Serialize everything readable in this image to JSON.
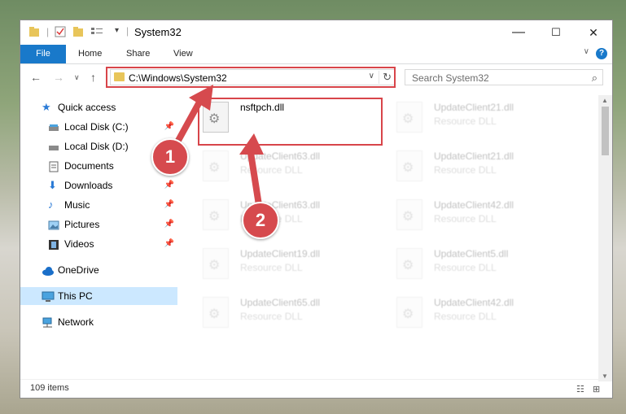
{
  "window": {
    "title": "System32",
    "controls": {
      "minimize": "—",
      "maximize": "☐",
      "close": "✕"
    }
  },
  "ribbon": {
    "file_label": "File",
    "tabs": [
      "Home",
      "Share",
      "View"
    ],
    "help_label": "?"
  },
  "address": {
    "path": "C:\\Windows\\System32",
    "search_placeholder": "Search System32"
  },
  "sidebar": {
    "items": [
      {
        "label": "Quick access",
        "icon": "star-icon",
        "pinned": false
      },
      {
        "label": "Local Disk (C:)",
        "icon": "disk-icon",
        "pinned": true
      },
      {
        "label": "Local Disk (D:)",
        "icon": "disk-icon",
        "pinned": false
      },
      {
        "label": "Documents",
        "icon": "documents-icon",
        "pinned": false
      },
      {
        "label": "Downloads",
        "icon": "download-icon",
        "pinned": true
      },
      {
        "label": "Music",
        "icon": "music-icon",
        "pinned": true
      },
      {
        "label": "Pictures",
        "icon": "pictures-icon",
        "pinned": true
      },
      {
        "label": "Videos",
        "icon": "videos-icon",
        "pinned": true
      },
      {
        "label": "OneDrive",
        "icon": "cloud-icon",
        "pinned": false
      },
      {
        "label": "This PC",
        "icon": "computer-icon",
        "pinned": false,
        "selected": true
      },
      {
        "label": "Network",
        "icon": "network-icon",
        "pinned": false
      }
    ]
  },
  "files": {
    "highlighted": {
      "name": "nsftpch.dll",
      "type": ""
    },
    "left_column": [
      {
        "name": "UpdateClient63.dll",
        "type": "Resource DLL"
      },
      {
        "name": "UpdateClient63.dll",
        "type": "Resource DLL"
      },
      {
        "name": "UpdateClient19.dll",
        "type": "Resource DLL"
      },
      {
        "name": "UpdateClient65.dll",
        "type": "Resource DLL"
      }
    ],
    "right_column": [
      {
        "name": "UpdateClient21.dll",
        "type": "Resource DLL"
      },
      {
        "name": "UpdateClient21.dll",
        "type": "Resource DLL"
      },
      {
        "name": "UpdateClient42.dll",
        "type": "Resource DLL"
      },
      {
        "name": "UpdateClient5.dll",
        "type": "Resource DLL"
      },
      {
        "name": "UpdateClient42.dll",
        "type": "Resource DLL"
      }
    ]
  },
  "status": {
    "item_count": "109 items"
  },
  "annotations": {
    "step1": "1",
    "step2": "2",
    "color": "#d64a4e"
  }
}
